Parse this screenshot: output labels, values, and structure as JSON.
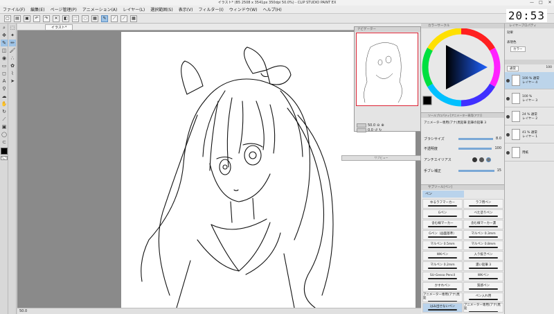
{
  "window": {
    "title": "イラスト* (B5 2508 x 3541px 350dpi 50.0%) - CLIP STUDIO PAINT EX",
    "controls": [
      "—",
      "□",
      "✕"
    ]
  },
  "menu": [
    "ファイル(F)",
    "編集(E)",
    "ページ管理(P)",
    "アニメーション(A)",
    "レイヤー(L)",
    "選択範囲(S)",
    "表示(V)",
    "フィルター(I)",
    "ウィンドウ(W)",
    "ヘルプ(H)"
  ],
  "clock": "20:53",
  "document": {
    "tab_label": "イラスト*",
    "status_zoom": "50.0"
  },
  "navigator": {
    "title": "ナビゲーター",
    "zoom": "50.0",
    "angle": "0.0"
  },
  "subview": {
    "title": "サブビュー"
  },
  "color_panel": {
    "title": "カラーサークル"
  },
  "tool_property": {
    "title": "ツールプロパティ[アニメーター専用(アナ)]",
    "tool_name": "アニメーター専用(アナ)黒鉛筆 鉛筆の鉛筆 3",
    "brush_size_label": "ブラシサイズ",
    "brush_size_value": "8.0",
    "opacity_label": "不透明度",
    "opacity_value": "100",
    "antialias_label": "アンチエイリアス",
    "stabilization_label": "手ブレ補正",
    "stabilization_value": "15"
  },
  "sub_tool": {
    "title": "サブツール[ペン]",
    "group": "ペン",
    "brushes": [
      "ゆるラフマーカー",
      "ラフ用ペン",
      "Gペン",
      "ベた塗りペン",
      "含む線マーカー",
      "含む線マーカー濃",
      "Gペン（画面基準）",
      "マルペン 0.3mm",
      "マルペン 0.5mm",
      "マルペン 0.8mm",
      "WKペン",
      "入り抜きペン",
      "マルペン 0.2mm",
      "濃い鉛筆 3",
      "SU-Gesso Pencil",
      "WKペン",
      "かすれペン",
      "質感ペン",
      "アニメーター専用(アナ)黒鉛",
      "ペン入れ用",
      "はみ出せないペン",
      "アニメーター専用(アナ)黒鉛"
    ],
    "selected_index": 20
  },
  "layer_panel": {
    "title": "レイヤープロパティ",
    "blend_mode": "通常",
    "opacity": "100",
    "layers": [
      {
        "name": "レイヤー 4",
        "info": "100 % 通常"
      },
      {
        "name": "レイヤー 3",
        "info": "100 %"
      },
      {
        "name": "レイヤー 2",
        "info": "24 % 通常"
      },
      {
        "name": "レイヤー 1",
        "info": "41 % 通常"
      },
      {
        "name": "用紙",
        "info": ""
      }
    ],
    "selected_index": 0,
    "effect_label": "効果",
    "color_label": "表現色",
    "color_value": "カラー"
  },
  "colors": {
    "accent": "#9ec3e6",
    "canvas_bg": "#8a8a8a",
    "current_color": "#000000"
  }
}
